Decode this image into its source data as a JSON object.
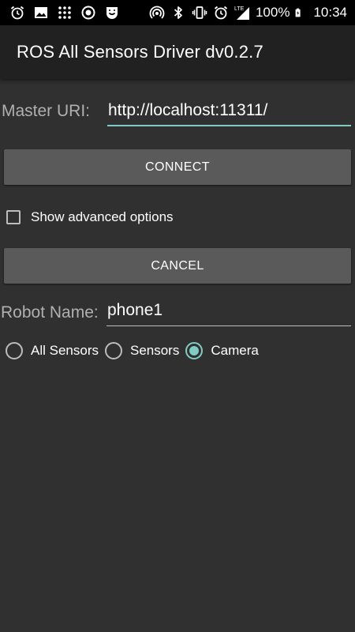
{
  "status_bar": {
    "left_icons": [
      "alarm-icon",
      "image-icon",
      "grid-dots-icon",
      "record-icon",
      "shield-smile-icon"
    ],
    "right_icons": [
      "hotspot-icon",
      "bluetooth-icon",
      "vibrate-icon",
      "alarm-icon",
      "lte-signal-icon",
      "battery-charging-icon"
    ],
    "lte_label": "LTE",
    "battery": "100%",
    "time": "10:34"
  },
  "app": {
    "title": "ROS All Sensors Driver dv0.2.7"
  },
  "master": {
    "label": "Master URI:",
    "value": "http://localhost:11311/"
  },
  "connect_button": "CONNECT",
  "advanced": {
    "label": "Show advanced options",
    "checked": false
  },
  "cancel_button": "CANCEL",
  "robot": {
    "label": "Robot Name:",
    "value": "phone1"
  },
  "mode": {
    "options": [
      "All Sensors",
      "Sensors",
      "Camera"
    ],
    "selected": "Camera"
  },
  "colors": {
    "accent": "#80cbc4",
    "background": "#303030",
    "appbar": "#212121",
    "button": "#5a5a5a"
  }
}
